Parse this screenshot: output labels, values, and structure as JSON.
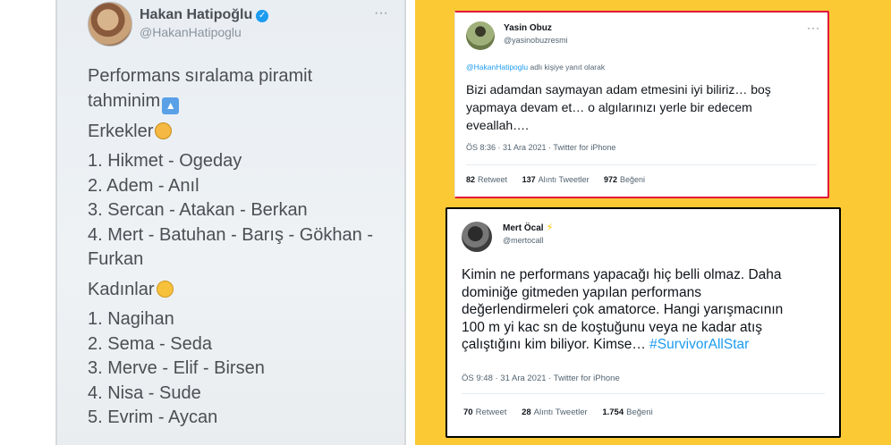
{
  "left_tweet": {
    "author_name": "Hakan Hatipoğlu",
    "author_handle": "@HakanHatipoglu",
    "more_icon": "···",
    "intro_line1": "Performans sıralama piramit",
    "intro_line2": "tahminim",
    "men_heading": "Erkekler",
    "men": [
      "1. Hikmet - Ogeday",
      "2. Adem - Anıl",
      "3. Sercan - Atakan - Berkan",
      "4. Mert - Batuhan - Barış - Gökhan -",
      "Furkan"
    ],
    "women_heading": "Kadınlar",
    "women": [
      "1. Nagihan",
      "2. Sema - Seda",
      "3. Merve - Elif - Birsen",
      "4. Nisa - Sude",
      "5. Evrim - Aycan"
    ]
  },
  "tweet_yasin": {
    "author_name": "Yasin Obuz",
    "author_handle": "@yasinobuzresmi",
    "reply_mention": "@HakanHatipoglu",
    "reply_suffix": " adlı kişiye yanıt olarak",
    "text_lines": [
      "Bizi adamdan saymayan adam etmesini iyi biliriz… boş",
      "yapmaya devam et… o algılarınızı yerle bir edecem",
      "eveallah…."
    ],
    "meta": "ÖS 8:36 · 31 Ara 2021 · Twitter for iPhone",
    "retweets_count": "82",
    "retweets_label": "Retweet",
    "quotes_count": "137",
    "quotes_label": "Alıntı Tweetler",
    "likes_count": "972",
    "likes_label": "Beğeni"
  },
  "tweet_mert": {
    "author_name": "Mert Öcal",
    "author_handle": "@mertocall",
    "text_lines": [
      "Kimin ne performans yapacağı hiç belli olmaz. Daha",
      "dominiğe gitmeden yapılan performans",
      "değerlendirmeleri çok amatorce. Hangi yarışmacının",
      "100 m yi kac sn de koştuğunu veya ne kadar atış",
      "çalıştığını kim biliyor. Kimse…"
    ],
    "hashtag": "#SurvivorAllStar",
    "meta": "ÖS 9:48 · 31 Ara 2021 · Twitter for iPhone",
    "retweets_count": "70",
    "retweets_label": "Retweet",
    "quotes_count": "28",
    "quotes_label": "Alıntı Tweetler",
    "likes_count": "1.754",
    "likes_label": "Beğeni"
  },
  "colors": {
    "background": "#fbc934",
    "link_blue": "#1d9bf0",
    "highlight_border": "#e0103a"
  }
}
